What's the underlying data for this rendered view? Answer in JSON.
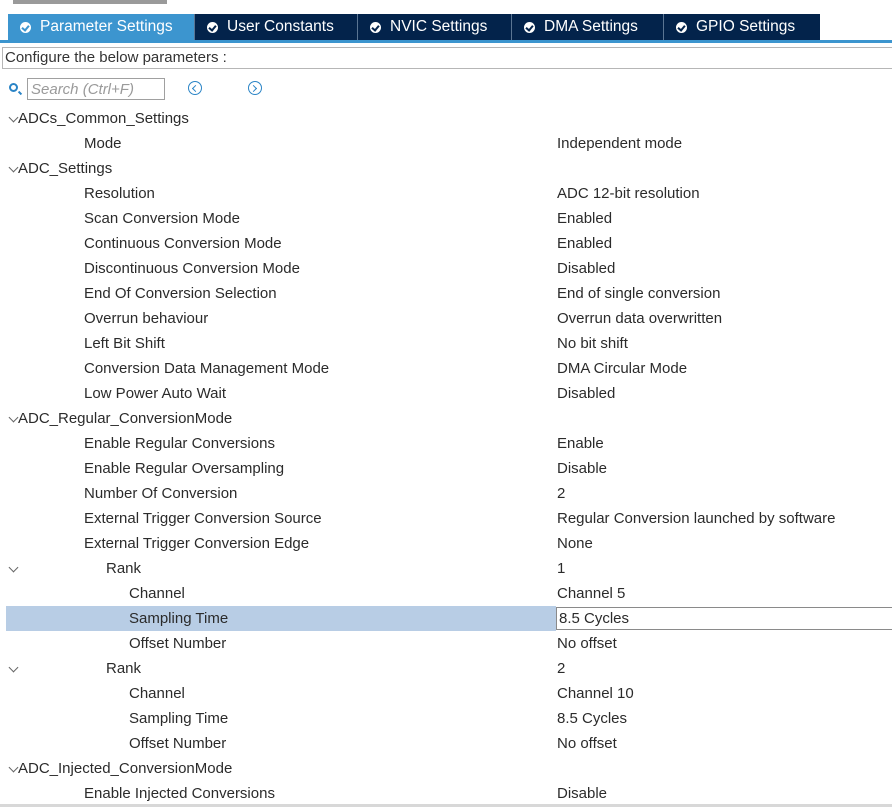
{
  "tabs": [
    {
      "label": "Parameter Settings",
      "active": true
    },
    {
      "label": "User Constants",
      "active": false
    },
    {
      "label": "NVIC Settings",
      "active": false
    },
    {
      "label": "DMA Settings",
      "active": false
    },
    {
      "label": "GPIO Settings",
      "active": false
    }
  ],
  "colors": {
    "tab_active": "#3c95cf",
    "tab_inactive": "#03234b",
    "selection": "#b8cde5",
    "icon_accent": "#2a84c6"
  },
  "header": {
    "configure_text": "Configure the below parameters :"
  },
  "search": {
    "placeholder": "Search (Ctrl+F)",
    "prev_icon": "chevron-left-circle-icon",
    "next_icon": "chevron-right-circle-icon"
  },
  "tree": [
    {
      "label": "ADCs_Common_Settings",
      "value": "",
      "level": 0,
      "group": true
    },
    {
      "label": "Mode",
      "value": "Independent mode",
      "level": 1
    },
    {
      "label": "ADC_Settings",
      "value": "",
      "level": 0,
      "group": true
    },
    {
      "label": "Resolution",
      "value": "ADC 12-bit resolution",
      "level": 1
    },
    {
      "label": "Scan Conversion Mode",
      "value": "Enabled",
      "level": 1
    },
    {
      "label": "Continuous Conversion Mode",
      "value": "Enabled",
      "level": 1
    },
    {
      "label": "Discontinuous Conversion Mode",
      "value": "Disabled",
      "level": 1
    },
    {
      "label": "End Of Conversion Selection",
      "value": "End of single conversion",
      "level": 1
    },
    {
      "label": "Overrun behaviour",
      "value": "Overrun data overwritten",
      "level": 1
    },
    {
      "label": "Left Bit Shift",
      "value": "No bit shift",
      "level": 1
    },
    {
      "label": "Conversion Data Management Mode",
      "value": "DMA Circular Mode",
      "level": 1
    },
    {
      "label": "Low Power Auto Wait",
      "value": "Disabled",
      "level": 1
    },
    {
      "label": "ADC_Regular_ConversionMode",
      "value": "",
      "level": 0,
      "group": true
    },
    {
      "label": "Enable Regular Conversions",
      "value": "Enable",
      "level": 1
    },
    {
      "label": "Enable Regular Oversampling",
      "value": "Disable",
      "level": 1
    },
    {
      "label": "Number Of Conversion",
      "value": "2",
      "level": 1
    },
    {
      "label": "External Trigger Conversion Source",
      "value": "Regular Conversion launched by software",
      "level": 1
    },
    {
      "label": "External Trigger Conversion Edge",
      "value": "None",
      "level": 1
    },
    {
      "label": "Rank",
      "value": "1",
      "level": 2,
      "group": true
    },
    {
      "label": "Channel",
      "value": "Channel 5",
      "level": 3
    },
    {
      "label": "Sampling Time",
      "value": "8.5 Cycles",
      "level": 3,
      "selected": true
    },
    {
      "label": "Offset Number",
      "value": "No offset",
      "level": 3
    },
    {
      "label": "Rank",
      "value": "2",
      "level": 2,
      "group": true
    },
    {
      "label": "Channel",
      "value": "Channel 10",
      "level": 3
    },
    {
      "label": "Sampling Time",
      "value": "8.5 Cycles",
      "level": 3
    },
    {
      "label": "Offset Number",
      "value": "No offset",
      "level": 3
    },
    {
      "label": "ADC_Injected_ConversionMode",
      "value": "",
      "level": 0,
      "group": true
    },
    {
      "label": "Enable Injected Conversions",
      "value": "Disable",
      "level": 1
    }
  ]
}
